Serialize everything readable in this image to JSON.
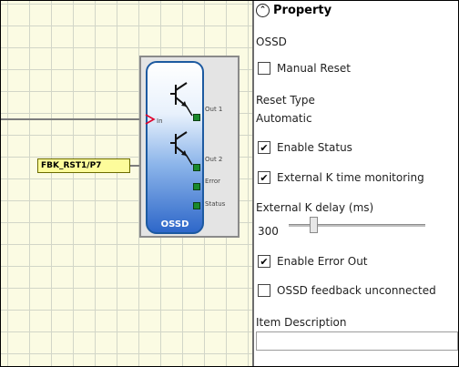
{
  "block": {
    "title": "OSSD",
    "ports": {
      "in": "In",
      "out1": "Out 1",
      "out2": "Out 2",
      "error": "Error",
      "status": "Status"
    }
  },
  "input_tag": {
    "label": "FBK_RST1/P7"
  },
  "panel": {
    "title": "Property",
    "block_name": "OSSD",
    "manual_reset": {
      "label": "Manual Reset",
      "checked": false
    },
    "reset_type": {
      "label": "Reset Type",
      "value": "Automatic"
    },
    "enable_status": {
      "label": "Enable Status",
      "checked": true
    },
    "external_k_monitoring": {
      "label": "External K time monitoring",
      "checked": true
    },
    "external_k_delay": {
      "label": "External K delay (ms)",
      "value": "300"
    },
    "enable_error_out": {
      "label": "Enable Error Out",
      "checked": true
    },
    "ossd_feedback_unconnected": {
      "label": "OSSD feedback unconnected",
      "checked": false
    },
    "item_description": {
      "label": "Item Description",
      "value": ""
    }
  }
}
